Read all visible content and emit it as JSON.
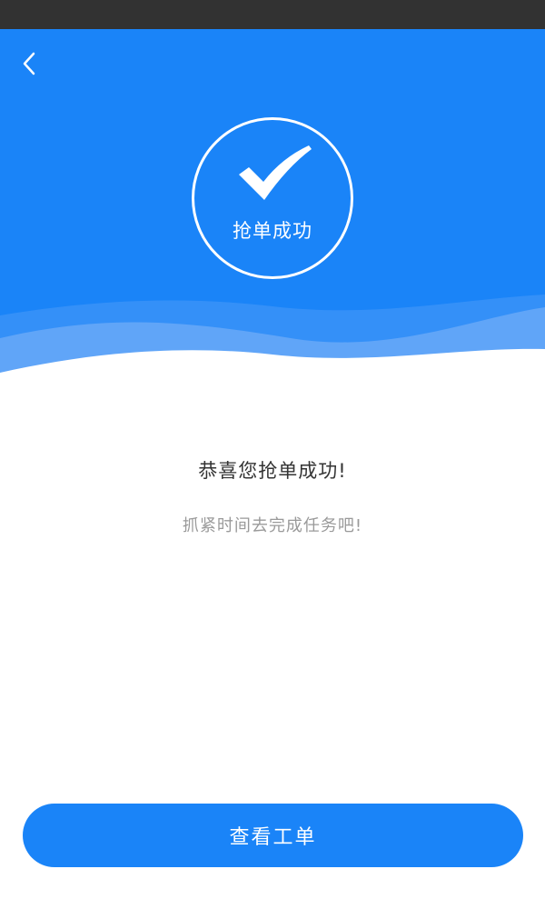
{
  "status_bar": {
    "color": "#323232"
  },
  "header": {
    "back_icon": "chevron-left-icon",
    "background_color": "#1a84f8"
  },
  "success_badge": {
    "icon": "checkmark-icon",
    "label": "抢单成功"
  },
  "message": {
    "title": "恭喜您抢单成功!",
    "subtitle": "抓紧时间去完成任务吧!"
  },
  "actions": {
    "view_order_label": "查看工单",
    "button_color": "#1a84f8"
  }
}
